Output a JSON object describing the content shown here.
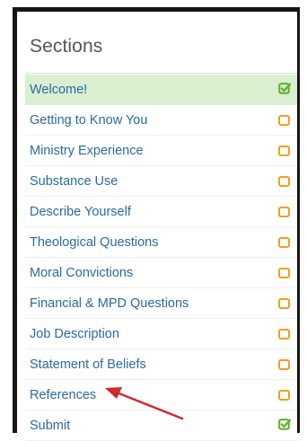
{
  "sidebar": {
    "title": "Sections",
    "items": [
      {
        "label": "Welcome!",
        "status": "complete",
        "active": true
      },
      {
        "label": "Getting to Know You",
        "status": "incomplete",
        "active": false
      },
      {
        "label": "Ministry Experience",
        "status": "incomplete",
        "active": false
      },
      {
        "label": "Substance Use",
        "status": "incomplete",
        "active": false
      },
      {
        "label": "Describe Yourself",
        "status": "incomplete",
        "active": false
      },
      {
        "label": "Theological Questions",
        "status": "incomplete",
        "active": false
      },
      {
        "label": "Moral Convictions",
        "status": "incomplete",
        "active": false
      },
      {
        "label": "Financial & MPD Questions",
        "status": "incomplete",
        "active": false
      },
      {
        "label": "Job Description",
        "status": "incomplete",
        "active": false
      },
      {
        "label": "Statement of Beliefs",
        "status": "incomplete",
        "active": false
      },
      {
        "label": "References",
        "status": "incomplete",
        "active": false
      },
      {
        "label": "Submit",
        "status": "complete",
        "active": false
      }
    ]
  },
  "colors": {
    "link": "#2a6aa6",
    "active_bg": "#d9efcf",
    "complete_icon": "#62b332",
    "incomplete_icon": "#f0a020",
    "annotation_arrow": "#d0282c"
  },
  "icons": {
    "complete": "checked-square-icon",
    "incomplete": "empty-square-icon"
  }
}
